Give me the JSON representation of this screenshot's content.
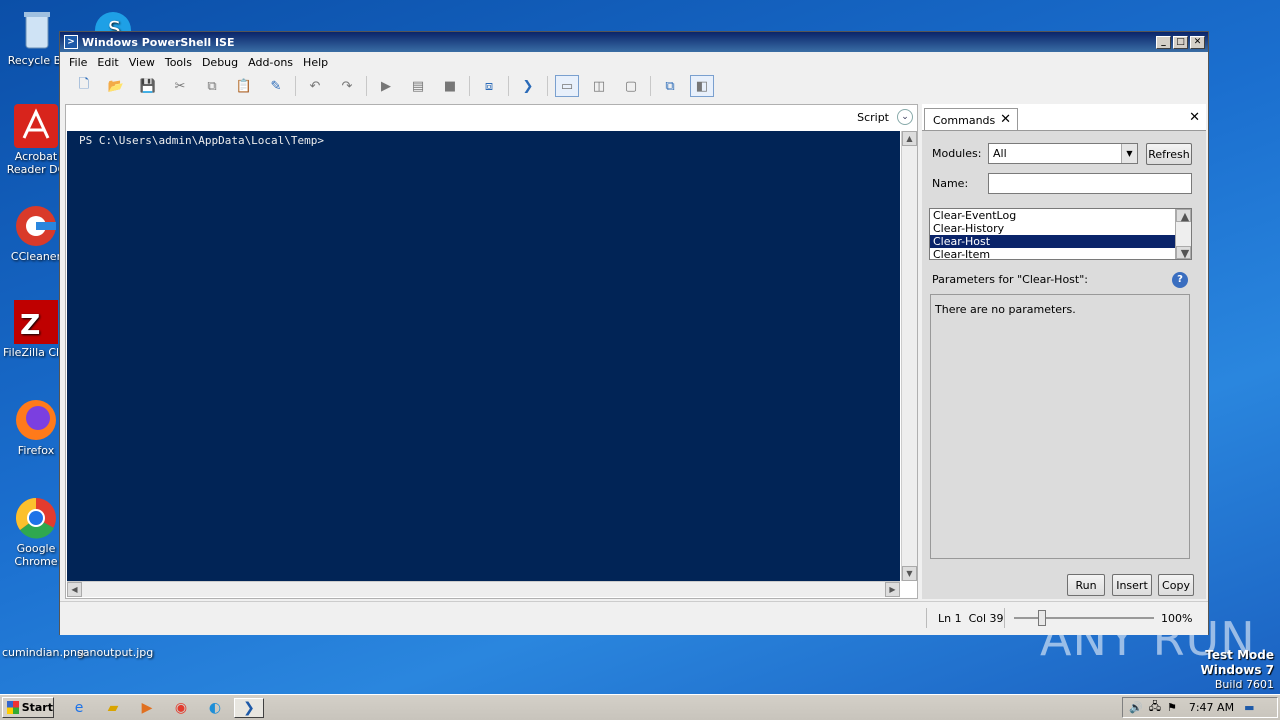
{
  "desktop": {
    "icons": [
      {
        "label": "Recycle Bi",
        "icon": "recycle-bin-icon"
      },
      {
        "label": "Acrobat Reader DC",
        "icon": "acrobat-icon"
      },
      {
        "label": "CCleaner",
        "icon": "ccleaner-icon"
      },
      {
        "label": "FileZilla Clie",
        "icon": "filezilla-icon"
      },
      {
        "label": "Firefox",
        "icon": "firefox-icon"
      },
      {
        "label": "Google Chrome",
        "icon": "chrome-icon"
      }
    ],
    "files": [
      "cumindian.png",
      "sanoutput.jpg"
    ],
    "watermark": "ANY RUN",
    "test_mode": {
      "line1": "Test Mode",
      "line2": "Windows 7",
      "line3": "Build 7601"
    }
  },
  "window": {
    "title": "Windows PowerShell ISE",
    "menu": [
      "File",
      "Edit",
      "View",
      "Tools",
      "Debug",
      "Add-ons",
      "Help"
    ]
  },
  "script_pane": {
    "label": "Script",
    "console_prompt": "PS C:\\Users\\admin\\AppData\\Local\\Temp>"
  },
  "commands": {
    "tab_label": "Commands",
    "modules_label": "Modules:",
    "modules_value": "All",
    "refresh_label": "Refresh",
    "name_label": "Name:",
    "name_value": "",
    "list": [
      "Clear-EventLog",
      "Clear-History",
      "Clear-Host",
      "Clear-Item"
    ],
    "selected": "Clear-Host",
    "params_title": "Parameters for \"Clear-Host\":",
    "params_text": "There are no parameters.",
    "run_label": "Run",
    "insert_label": "Insert",
    "copy_label": "Copy"
  },
  "status": {
    "position": "Ln 1  Col 39",
    "zoom": "100%",
    "zoom_level": 0.2
  },
  "taskbar": {
    "start_label": "Start",
    "clock": "7:47 AM"
  }
}
